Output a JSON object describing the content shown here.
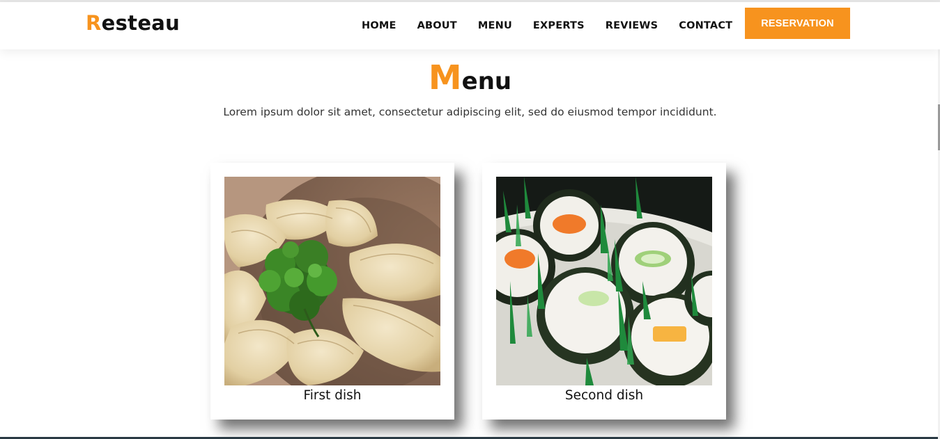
{
  "header": {
    "logo_first_letter": "R",
    "logo_rest": "esteau",
    "nav": [
      "HOME",
      "ABOUT",
      "MENU",
      "EXPERTS",
      "REVIEWS",
      "CONTACT"
    ],
    "reservation_label": "RESERVATION"
  },
  "menu_section": {
    "title_first_letter": "M",
    "title_rest": "enu",
    "subtitle": "Lorem ipsum dolor sit amet, consectetur adipiscing elit, sed do eiusmod tempor incididunt.",
    "cards": [
      {
        "caption": "First dish",
        "image": "dumplings-photo"
      },
      {
        "caption": "Second dish",
        "image": "sushi-photo"
      }
    ]
  },
  "colors": {
    "accent": "#f7931e",
    "text": "#111111",
    "background": "#ffffff"
  }
}
